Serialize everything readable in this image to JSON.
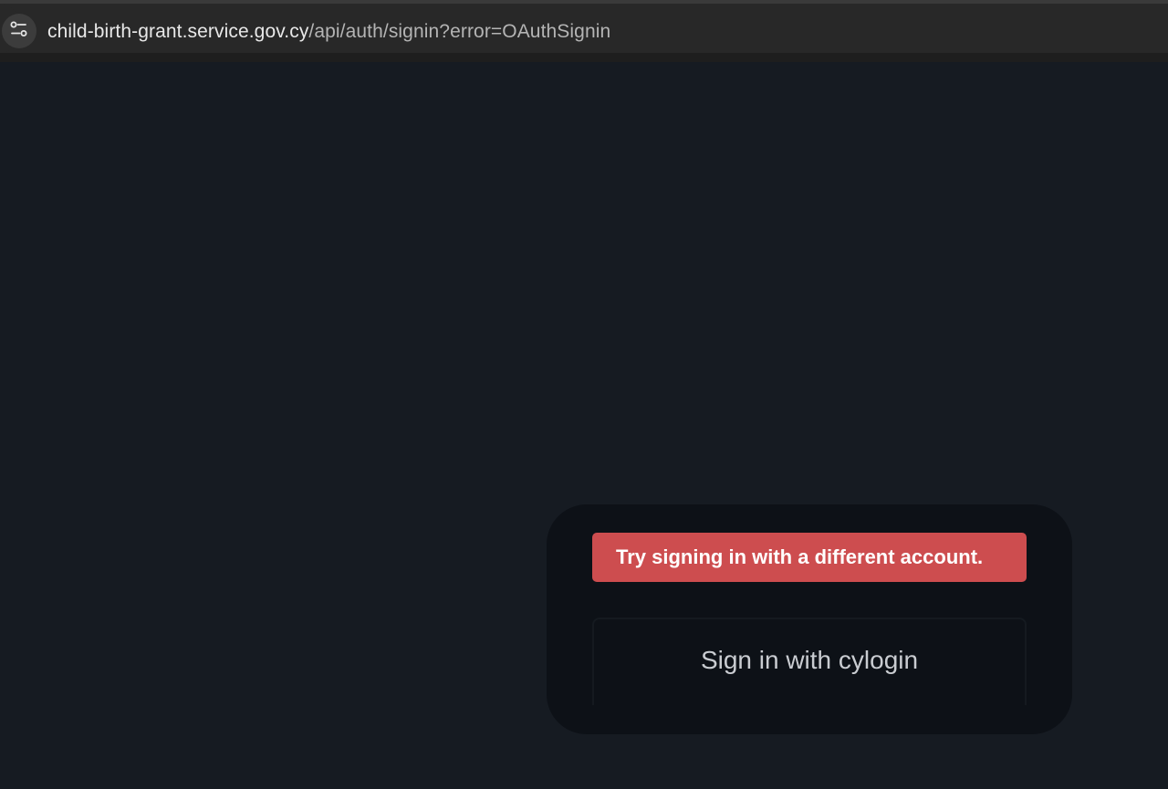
{
  "browser": {
    "url_host": "child-birth-grant.service.gov.cy",
    "url_path": "/api/auth/signin?error=OAuthSignin",
    "site_info_icon": "tune-icon"
  },
  "signin_card": {
    "error_message": "Try signing in with a different account.",
    "signin_button_label": "Sign in with cylogin"
  },
  "colors": {
    "page_background": "#161b22",
    "card_background": "#0d1117",
    "error_background": "#cd4d4f"
  }
}
